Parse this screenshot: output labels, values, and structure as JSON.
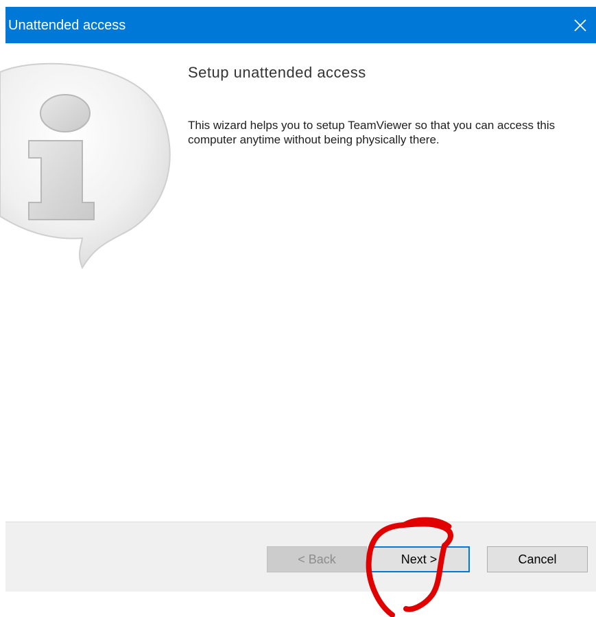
{
  "window": {
    "title": "Unattended access",
    "close_icon": "close-icon",
    "titlebar_color": "#0078d7"
  },
  "wizard": {
    "icon": "info-speech-bubble-icon",
    "heading": "Setup unattended access",
    "description": "This wizard helps you to setup TeamViewer so that you can access this computer anytime without being physically there."
  },
  "buttons": {
    "back_label": "< Back",
    "back_enabled": false,
    "next_label": "Next >",
    "cancel_label": "Cancel"
  },
  "annotation": {
    "type": "hand-drawn-circle",
    "color": "#e00000",
    "target": "next-button"
  }
}
